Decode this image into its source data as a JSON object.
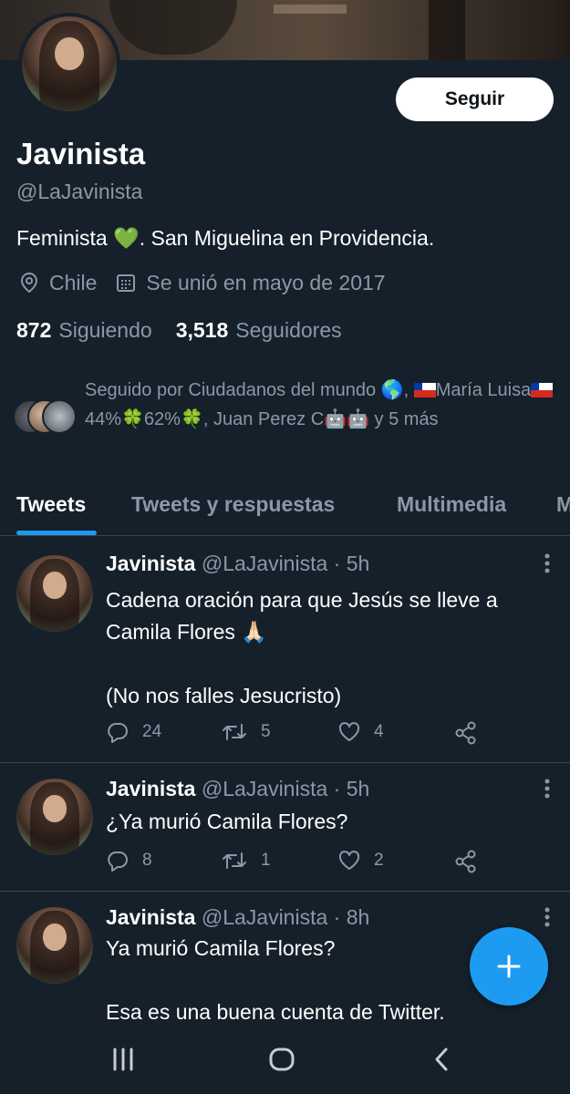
{
  "profile": {
    "display_name": "Javinista",
    "handle": "@LaJavinista",
    "follow_label": "Seguir",
    "bio_prefix": "Feminista ",
    "bio_emoji": "💚",
    "bio_suffix": ". San Miguelina en Providencia.",
    "location": "Chile",
    "joined": "Se unió en mayo de 2017",
    "following_count": "872",
    "following_label": "Siguiendo",
    "followers_count": "3,518",
    "followers_label": "Seguidores",
    "followed_by": {
      "prefix": "Seguido por Ciudadanos del mundo ",
      "globe": "🌎",
      "sep": ", ",
      "part2": "María Luisa",
      "part3": "44%",
      "clover": "🍀",
      "part4": "62%",
      "part5": ", Juan Perez C",
      "robot": "🤖",
      "suffix": " y 5 más"
    }
  },
  "tabs": [
    {
      "label": "Tweets",
      "active": true
    },
    {
      "label": "Tweets y respuestas",
      "active": false
    },
    {
      "label": "Multimedia",
      "active": false
    },
    {
      "label": "M",
      "active": false
    }
  ],
  "tweets": [
    {
      "name": "Javinista",
      "handle": "@LaJavinista",
      "time": "· 5h",
      "line1": "Cadena oración para que Jesús se lleve a",
      "line2": "Camila Flores 🙏🏻",
      "line3": "",
      "line4": "(No nos falles Jesucristo)",
      "replies": "24",
      "retweets": "5",
      "likes": "4"
    },
    {
      "name": "Javinista",
      "handle": "@LaJavinista",
      "time": "· 5h",
      "line1": "¿Ya murió Camila Flores?",
      "replies": "8",
      "retweets": "1",
      "likes": "2"
    },
    {
      "name": "Javinista",
      "handle": "@LaJavinista",
      "time": "· 8h",
      "line1": "Ya murió Camila Flores?",
      "line2": "",
      "line3": "Esa es una buena cuenta de Twitter."
    }
  ],
  "icons": {
    "location": "location-pin-icon",
    "calendar": "calendar-icon",
    "reply": "reply-icon",
    "retweet": "retweet-icon",
    "like": "heart-icon",
    "share": "share-icon",
    "compose": "compose-plus-icon"
  },
  "colors": {
    "background": "#15202b",
    "accent": "#1d9bf0",
    "muted_text": "#8b98a5",
    "divider": "#38444d"
  }
}
